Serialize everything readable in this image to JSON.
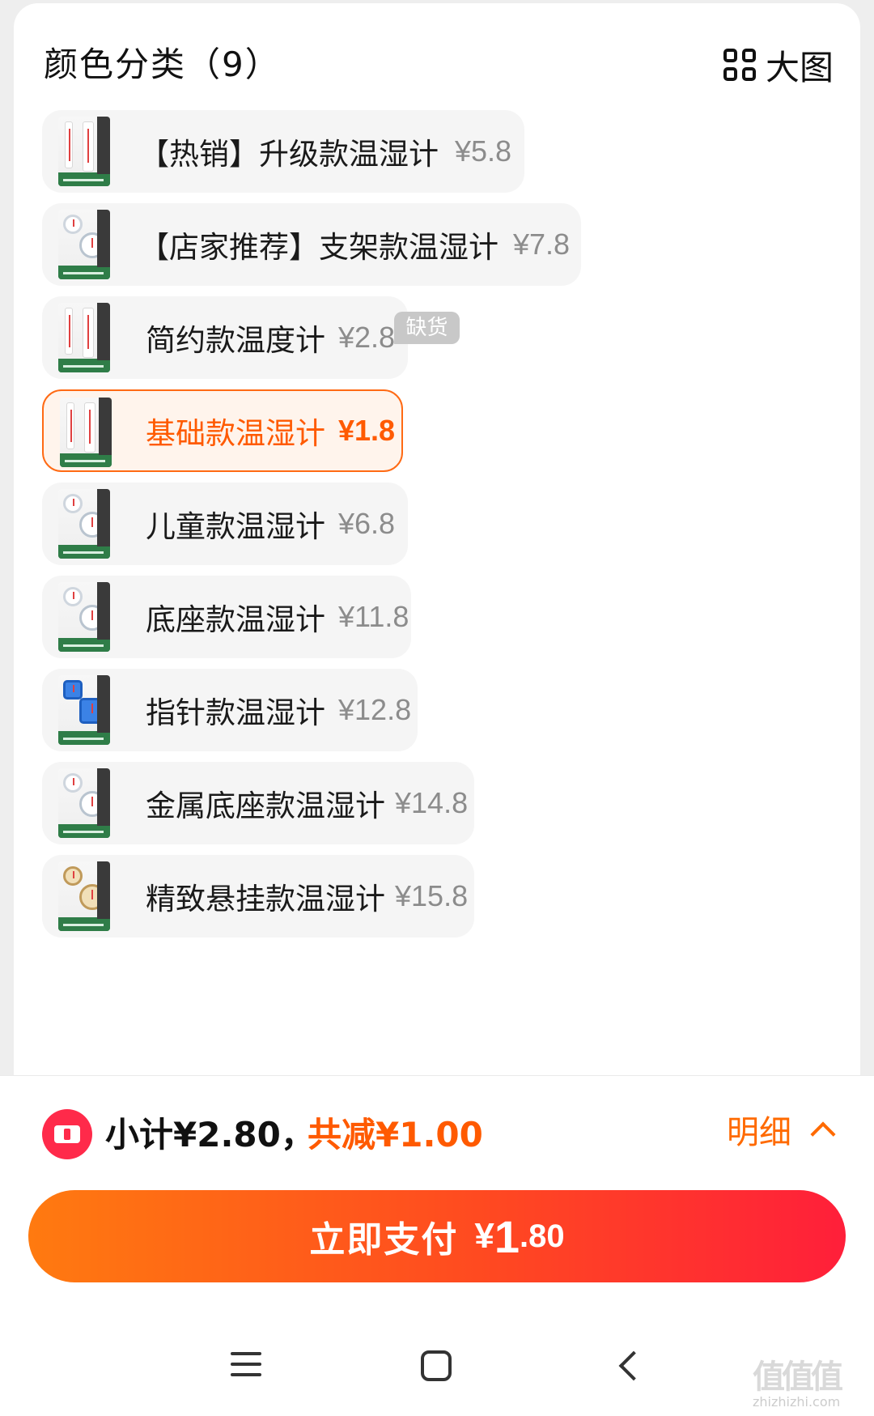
{
  "header": {
    "title": "颜色分类（9）",
    "big_view_label": "大图"
  },
  "options": [
    {
      "label": "【热销】升级款温湿计",
      "price": "¥5.8",
      "thumb": "thermo-hygrometer-strip",
      "selected": false,
      "out_of_stock": false
    },
    {
      "label": "【店家推荐】支架款温湿计",
      "price": "¥7.8",
      "thumb": "thermo-hygrometer-dial",
      "selected": false,
      "out_of_stock": true
    },
    {
      "label": "简约款温度计",
      "price": "¥2.8",
      "thumb": "thermometer-strip",
      "selected": false,
      "out_of_stock": false
    },
    {
      "label": "基础款温湿计",
      "price": "¥1.8",
      "thumb": "thermo-hygrometer-strip",
      "selected": true,
      "out_of_stock": false
    },
    {
      "label": "儿童款温湿计",
      "price": "¥6.8",
      "thumb": "thermo-hygrometer-dial",
      "selected": false,
      "out_of_stock": false
    },
    {
      "label": "底座款温湿计",
      "price": "¥11.8",
      "thumb": "thermo-hygrometer-dial",
      "selected": false,
      "out_of_stock": false
    },
    {
      "label": "指针款温湿计",
      "price": "¥12.8",
      "thumb": "thermo-hygrometer-blue",
      "selected": false,
      "out_of_stock": false
    },
    {
      "label": "金属底座款温湿计",
      "price": "¥14.8",
      "thumb": "thermo-hygrometer-dial",
      "selected": false,
      "out_of_stock": false
    },
    {
      "label": "精致悬挂款温湿计",
      "price": "¥15.8",
      "thumb": "thermo-hygrometer-gold",
      "selected": false,
      "out_of_stock": false
    }
  ],
  "out_of_stock_label": "缺货",
  "footer": {
    "subtotal": "小计¥2.80，",
    "discount": "共减¥1.00",
    "detail_label": "明细",
    "pay_label": "立即支付",
    "pay_currency": "¥",
    "pay_int": "1",
    "pay_dec": ".80"
  },
  "watermark": {
    "glyphs": "值值值",
    "text": "zhizhizhi.com"
  },
  "colors": {
    "accent": "#ff5a00",
    "selected_border": "#ff6a14",
    "pay_gradient_start": "#ff7a10",
    "pay_gradient_end": "#ff1f3a",
    "coupon_red": "#ff2a4a"
  }
}
